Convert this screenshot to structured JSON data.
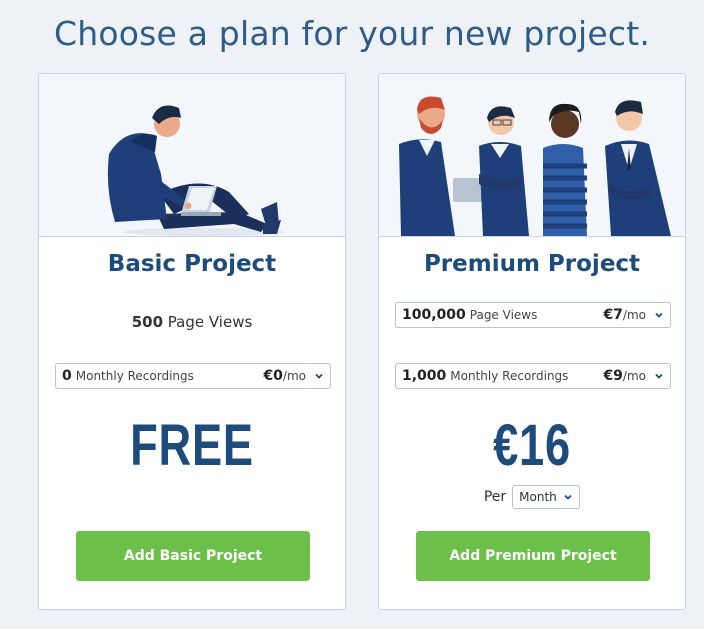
{
  "header": {
    "title": "Choose a plan for your new project."
  },
  "plans": {
    "basic": {
      "title": "Basic Project",
      "page_views": {
        "qty": "500",
        "unit": "Page Views"
      },
      "recordings": {
        "qty": "0",
        "unit": "Monthly Recordings",
        "price": "€0",
        "per": "/mo"
      },
      "price_display": "FREE",
      "cta": "Add Basic Project"
    },
    "premium": {
      "title": "Premium Project",
      "page_views": {
        "qty": "100,000",
        "unit": "Page Views",
        "price": "€7",
        "per": "/mo"
      },
      "recordings": {
        "qty": "1,000",
        "unit": "Monthly Recordings",
        "price": "€9",
        "per": "/mo"
      },
      "price_display": "€16",
      "per_label": "Per",
      "period": "Month",
      "cta": "Add Premium Project"
    }
  },
  "colors": {
    "accent_blue": "#1d4b7c",
    "title_blue": "#2d5c8a",
    "cta_green": "#6cc04a"
  },
  "icons": [
    "chevron-down-icon"
  ]
}
